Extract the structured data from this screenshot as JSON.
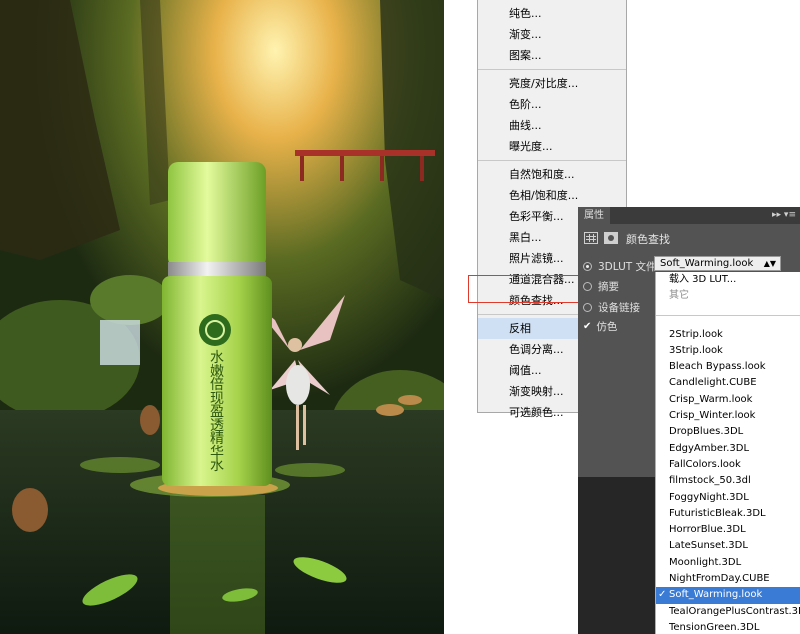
{
  "artwork": {
    "vertical_caption": [
      "水",
      "嫩",
      "倍",
      "现",
      "盈",
      "透",
      "精",
      "华",
      "水"
    ]
  },
  "adjustment_menu": {
    "groups": [
      [
        "纯色...",
        "渐变...",
        "图案..."
      ],
      [
        "亮度/对比度...",
        "色阶...",
        "曲线...",
        "曝光度..."
      ],
      [
        "自然饱和度...",
        "色相/饱和度...",
        "色彩平衡...",
        "黑白...",
        "照片滤镜...",
        "通道混合器...",
        "颜色查找..."
      ],
      [
        "反相",
        "色调分离...",
        "阈值...",
        "渐变映射...",
        "可选颜色..."
      ]
    ],
    "highlighted_item": "反相",
    "annotated_item": "颜色查找..."
  },
  "properties_panel": {
    "tab_label": "属性",
    "tab_controls": "▸▸ ▾≡",
    "title": "颜色查找",
    "rows": [
      {
        "label": "3DLUT 文件",
        "type": "radio",
        "selected": true
      },
      {
        "label": "摘要",
        "type": "radio",
        "selected": false
      },
      {
        "label": "设备链接",
        "type": "radio",
        "selected": false
      },
      {
        "label": "仿色",
        "type": "checkbox",
        "checked": true
      }
    ],
    "lut_select_value": "Soft_Warming.look"
  },
  "lut_dropdown": {
    "top_items": [
      "载入 3D LUT...",
      "其它"
    ],
    "items": [
      "2Strip.look",
      "3Strip.look",
      "Bleach Bypass.look",
      "Candlelight.CUBE",
      "Crisp_Warm.look",
      "Crisp_Winter.look",
      "DropBlues.3DL",
      "EdgyAmber.3DL",
      "FallColors.look",
      "filmstock_50.3dl",
      "FoggyNight.3DL",
      "FuturisticBleak.3DL",
      "HorrorBlue.3DL",
      "LateSunset.3DL",
      "Moonlight.3DL",
      "NightFromDay.CUBE",
      "Soft_Warming.look",
      "TealOrangePlusContrast.3DL",
      "TensionGreen.3DL"
    ],
    "selected": "Soft_Warming.look",
    "selected_mark": "✓"
  },
  "colors": {
    "menu_bg": "#f0f0f0",
    "menu_highlight": "#cfe0f4",
    "annotation_red": "#e03a2c",
    "panel_bg": "#535353",
    "list_selected": "#3a7bd5"
  }
}
